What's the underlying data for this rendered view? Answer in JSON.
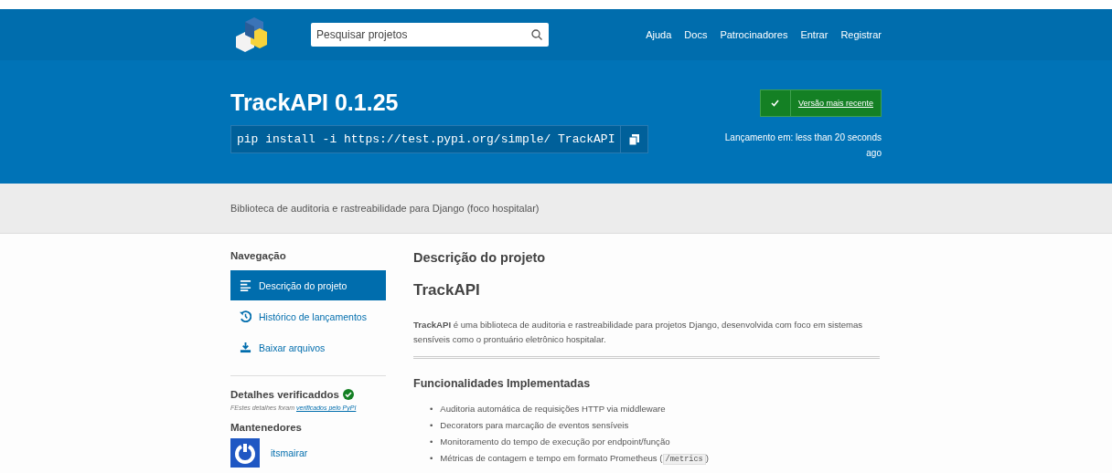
{
  "header": {
    "search": {
      "placeholder": "Pesquisar projetos"
    },
    "nav_links": [
      "Ajuda",
      "Docs",
      "Patrocinadores",
      "Entrar",
      "Registrar"
    ]
  },
  "project": {
    "title": "TrackAPI 0.1.25",
    "install_command": "pip install -i https://test.pypi.org/simple/ TrackAPI",
    "latest_badge": "Versão mais recente",
    "release_label": "Lançamento em: less than 20 seconds ago"
  },
  "summary": "Biblioteca de auditoria e rastreabilidade para Django (foco hospitalar)",
  "sidebar": {
    "heading": "Navegação",
    "items": [
      {
        "label": "Descrição do projeto",
        "selected": true
      },
      {
        "label": "Histórico de lançamentos",
        "selected": false
      },
      {
        "label": "Baixar arquivos",
        "selected": false
      }
    ],
    "verified": {
      "heading": "Detalhes verificaddos",
      "note": "FEstes detalhes foram",
      "link": "verificados pelo PyPI"
    },
    "maintainers": {
      "heading": "Mantenedores",
      "items": [
        {
          "name": "itsmairar"
        }
      ]
    }
  },
  "content": {
    "heading": "Descrição do projeto",
    "readme_title": "TrackAPI",
    "intro": "**TrackAPI** é uma biblioteca de auditoria e rastreabilidade para projetos Django, desenvolvida com foco em sistemas sensíveis como o prontuário eletrônico hospitalar.",
    "features_heading": "Funcionalidades Implementadas",
    "features": [
      {
        "bullet": "•",
        "parts": [
          {
            "kind": "text",
            "text": "Auditoria automática de requisições HTTP via middleware"
          }
        ]
      },
      {
        "bullet": "•",
        "parts": [
          {
            "kind": "text",
            "text": "Decorators para marcação de eventos sensíveis"
          }
        ]
      },
      {
        "bullet": "•",
        "parts": [
          {
            "kind": "text",
            "text": "Monitoramento do tempo de execução por endpoint/função"
          }
        ]
      },
      {
        "bullet": "•",
        "parts": [
          {
            "kind": "text",
            "text": "Métricas de contagem e tempo em formato Prometheus ("
          },
          {
            "kind": "code",
            "text": "/metrics"
          },
          {
            "kind": "text",
            "text": ")"
          }
        ]
      }
    ]
  }
}
